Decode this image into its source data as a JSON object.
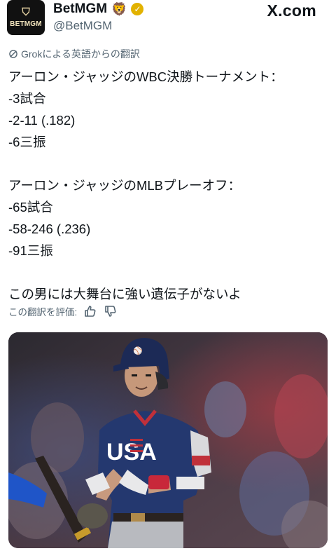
{
  "account": {
    "avatar_text": "BETMGM",
    "display_name": "BetMGM",
    "name_emoji": "🦁",
    "handle": "@BetMGM"
  },
  "site": {
    "label": "X.com"
  },
  "translation": {
    "label": "Grokによる英語からの翻訳"
  },
  "tweet": {
    "lines": [
      "アーロン・ジャッジのWBC決勝トーナメント：",
      "-3試合",
      "-2-11 (.182)",
      "-6三振",
      "",
      "アーロン・ジャッジのMLBプレーオフ：",
      "-65試合",
      "-58-246 (.236)",
      "-91三振",
      "",
      "この男には大舞台に強い遺伝子がないよ"
    ]
  },
  "rating": {
    "label": "この翻訳を評価:"
  },
  "media": {
    "jersey_text": "USA",
    "alt": ""
  },
  "icons": {
    "verified": "gold-verified-icon",
    "thumb_up": "thumb-up-icon",
    "thumb_down": "thumb-down-icon",
    "grok": "grok-icon"
  },
  "colors": {
    "accent_gold": "#e2b200",
    "muted": "#536471"
  }
}
